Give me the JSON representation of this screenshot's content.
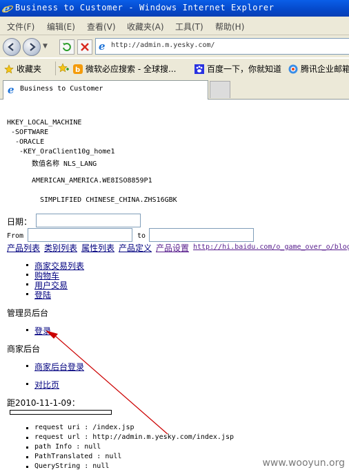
{
  "window": {
    "title": "Business to Customer - Windows Internet Explorer"
  },
  "menu": [
    "文件(F)",
    "编辑(E)",
    "查看(V)",
    "收藏夹(A)",
    "工具(T)",
    "帮助(H)"
  ],
  "address": {
    "url": "http://admin.m.yesky.com/"
  },
  "favorites": {
    "label": "收藏夹",
    "items": [
      "微软必应搜索 - 全球搜...",
      "百度一下，你就知道",
      "腾讯企业邮箱"
    ]
  },
  "tab": {
    "title": "Business to Customer"
  },
  "registry": {
    "l1": "HKEY_LOCAL_MACHINE",
    "l2": "-SOFTWARE",
    "l3": "-ORACLE",
    "l4": "-KEY_OraClient10g_home1",
    "l5": "数值名称 NLS_LANG",
    "l6": "AMERICAN_AMERICA.WE8ISO8859P1",
    "l7": "SIMPLIFIED CHINESE_CHINA.ZHS16GBK"
  },
  "form": {
    "date_label": "日期：",
    "from_label": "From",
    "to_label": "to"
  },
  "links_row": [
    "产品列表",
    "类别列表",
    "属性列表",
    "产品定义",
    "产品设置",
    "http://hi.baidu.com/o_game_over_o/blog"
  ],
  "list1": [
    "商家交易列表",
    "购物车",
    "用户交易",
    "登陆"
  ],
  "admin_heading": "管理员后台",
  "admin_list": [
    "登录"
  ],
  "merchant_heading": "商家后台",
  "merchant_list": [
    "商家后台登录",
    "对比页"
  ],
  "countdown": "距2010-11-1-09：",
  "request_info": [
    "request uri : /index.jsp",
    "request url : http://admin.m.yesky.com/index.jsp",
    "path Info : null",
    "PathTranslated : null",
    "QueryString : null"
  ],
  "watermark": "www.wooyun.org",
  "colors": {
    "titlebar": "#0548c9",
    "chrome": "#ece9d8",
    "link": "#00007f",
    "arrow": "#cc0000"
  }
}
